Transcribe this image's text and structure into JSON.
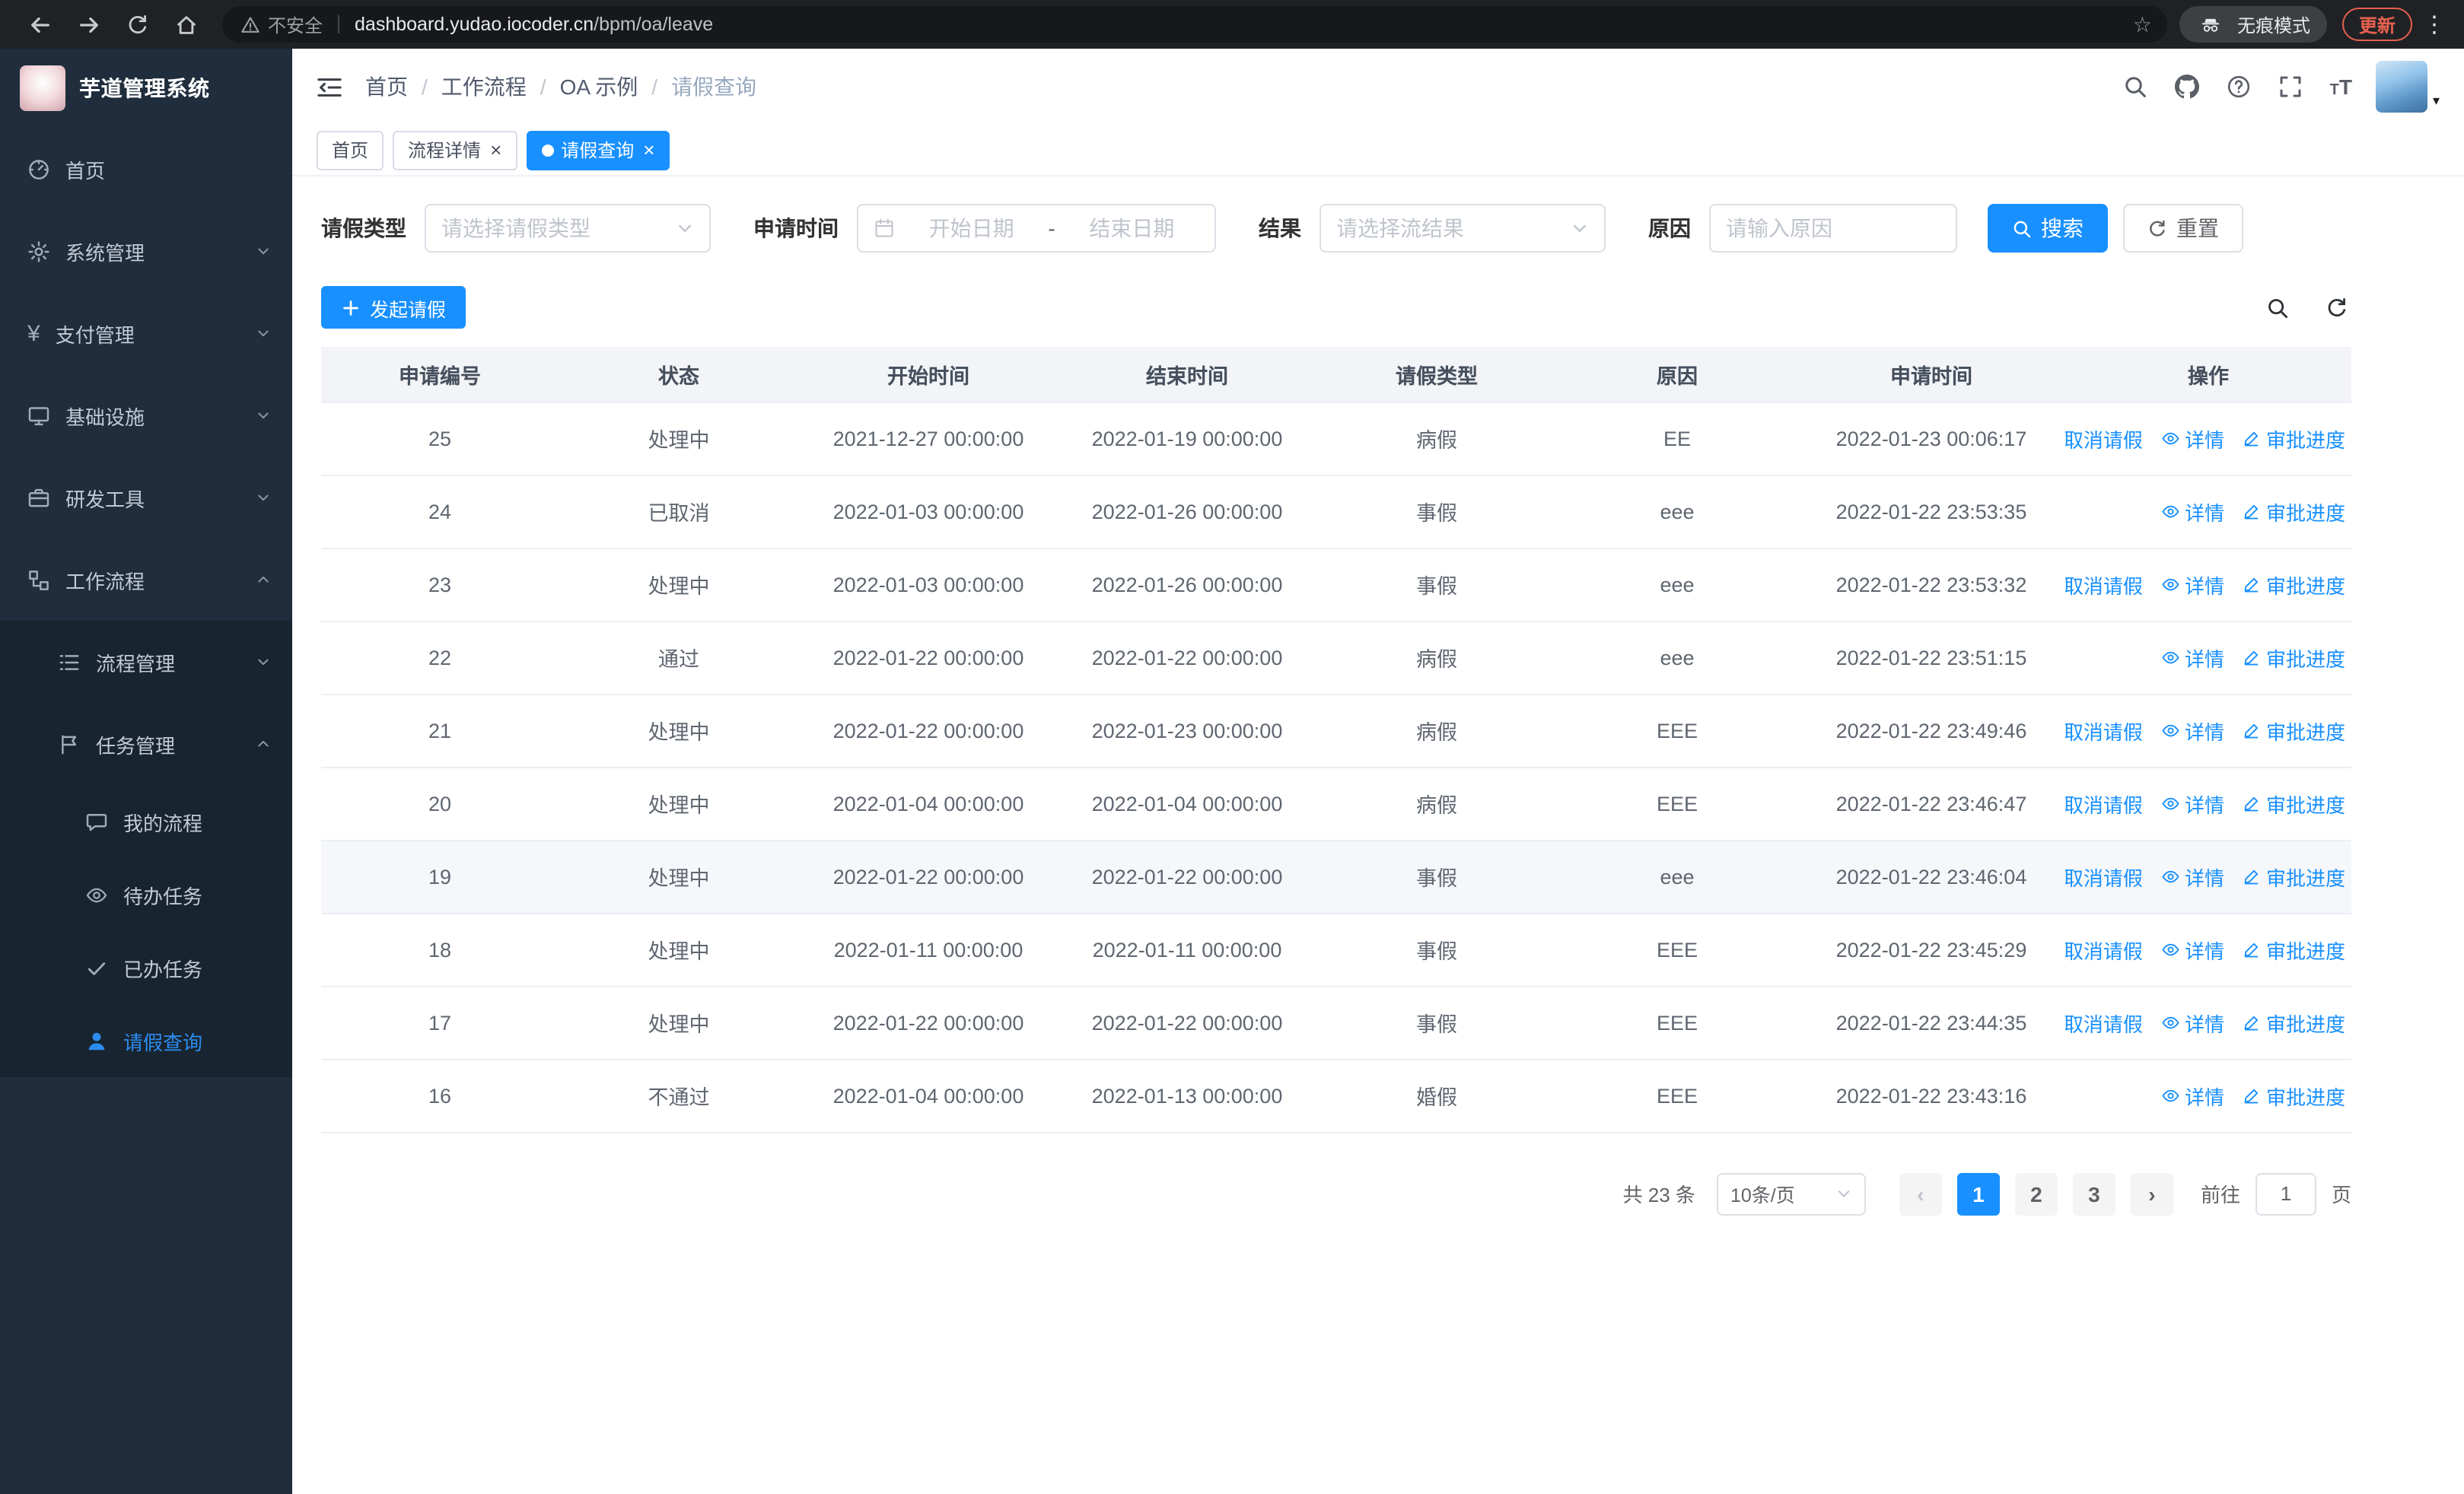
{
  "browser": {
    "security_warning": "不安全",
    "url_domain": "dashboard.yudao.iocoder.cn",
    "url_path": "/bpm/oa/leave",
    "incognito_label": "无痕模式",
    "update_label": "更新"
  },
  "colors": {
    "primary": "#1890ff",
    "sidebar_bg": "#1f2d3d",
    "sidebar_submenu_bg": "#18242f",
    "active_menu_text": "#2d8cf0",
    "table_header_bg": "#f3f4f7",
    "update_badge": "#e4604e"
  },
  "sidebar": {
    "logo_title": "芋道管理系统",
    "items": [
      {
        "key": "home",
        "label": "首页",
        "icon": "gauge",
        "level": 1
      },
      {
        "key": "system",
        "label": "系统管理",
        "icon": "gear",
        "level": 1,
        "expandable": true,
        "expanded": false
      },
      {
        "key": "payment",
        "label": "支付管理",
        "icon": "yen",
        "level": 1,
        "expandable": true,
        "expanded": false
      },
      {
        "key": "infrastructure",
        "label": "基础设施",
        "icon": "monitor",
        "level": 1,
        "expandable": true,
        "expanded": false
      },
      {
        "key": "devtools",
        "label": "研发工具",
        "icon": "briefcase",
        "level": 1,
        "expandable": true,
        "expanded": false
      },
      {
        "key": "workflow",
        "label": "工作流程",
        "icon": "flow",
        "level": 1,
        "expandable": true,
        "expanded": true
      },
      {
        "key": "process-mgmt",
        "label": "流程管理",
        "icon": "list",
        "level": 2,
        "expandable": true,
        "expanded": false
      },
      {
        "key": "task-mgmt",
        "label": "任务管理",
        "icon": "flag",
        "level": 2,
        "expandable": true,
        "expanded": true
      },
      {
        "key": "my-process",
        "label": "我的流程",
        "icon": "chat",
        "level": 3
      },
      {
        "key": "todo-tasks",
        "label": "待办任务",
        "icon": "eye",
        "level": 3
      },
      {
        "key": "done-tasks",
        "label": "已办任务",
        "icon": "check",
        "level": 3
      },
      {
        "key": "leave-query",
        "label": "请假查询",
        "icon": "user",
        "level": 3,
        "active": true
      }
    ]
  },
  "header": {
    "breadcrumb": [
      "首页",
      "工作流程",
      "OA 示例",
      "请假查询"
    ],
    "actions": [
      {
        "icon": "search",
        "name": "search-icon"
      },
      {
        "icon": "github",
        "name": "github-icon"
      },
      {
        "icon": "question",
        "name": "help-icon"
      },
      {
        "icon": "fullscreen",
        "name": "fullscreen-icon"
      },
      {
        "icon": "fontsize",
        "name": "font-size-icon"
      }
    ]
  },
  "tabs": [
    {
      "key": "home",
      "label": "首页",
      "closable": false,
      "active": false
    },
    {
      "key": "process-detail",
      "label": "流程详情",
      "closable": true,
      "active": false
    },
    {
      "key": "leave-query",
      "label": "请假查询",
      "closable": true,
      "active": true
    }
  ],
  "filters": {
    "leave_type_label": "请假类型",
    "leave_type_placeholder": "请选择请假类型",
    "apply_time_label": "申请时间",
    "start_date_placeholder": "开始日期",
    "range_separator": "-",
    "end_date_placeholder": "结束日期",
    "result_label": "结果",
    "result_placeholder": "请选择流结果",
    "reason_label": "原因",
    "reason_placeholder": "请输入原因",
    "search_label": "搜索",
    "reset_label": "重置"
  },
  "toolbar": {
    "create_label": "发起请假"
  },
  "table": {
    "columns": [
      "申请编号",
      "状态",
      "开始时间",
      "结束时间",
      "请假类型",
      "原因",
      "申请时间",
      "操作"
    ],
    "actions": {
      "cancel": "取消请假",
      "detail": "详情",
      "progress": "审批进度"
    },
    "rows": [
      {
        "id": "25",
        "status": "处理中",
        "start": "2021-12-27 00:00:00",
        "end": "2022-01-19 00:00:00",
        "type": "病假",
        "reason": "EE",
        "apply": "2022-01-23 00:06:17",
        "cancellable": true,
        "highlighted": false
      },
      {
        "id": "24",
        "status": "已取消",
        "start": "2022-01-03 00:00:00",
        "end": "2022-01-26 00:00:00",
        "type": "事假",
        "reason": "eee",
        "apply": "2022-01-22 23:53:35",
        "cancellable": false,
        "highlighted": false
      },
      {
        "id": "23",
        "status": "处理中",
        "start": "2022-01-03 00:00:00",
        "end": "2022-01-26 00:00:00",
        "type": "事假",
        "reason": "eee",
        "apply": "2022-01-22 23:53:32",
        "cancellable": true,
        "highlighted": false
      },
      {
        "id": "22",
        "status": "通过",
        "start": "2022-01-22 00:00:00",
        "end": "2022-01-22 00:00:00",
        "type": "病假",
        "reason": "eee",
        "apply": "2022-01-22 23:51:15",
        "cancellable": false,
        "highlighted": false
      },
      {
        "id": "21",
        "status": "处理中",
        "start": "2022-01-22 00:00:00",
        "end": "2022-01-23 00:00:00",
        "type": "病假",
        "reason": "EEE",
        "apply": "2022-01-22 23:49:46",
        "cancellable": true,
        "highlighted": false
      },
      {
        "id": "20",
        "status": "处理中",
        "start": "2022-01-04 00:00:00",
        "end": "2022-01-04 00:00:00",
        "type": "病假",
        "reason": "EEE",
        "apply": "2022-01-22 23:46:47",
        "cancellable": true,
        "highlighted": false
      },
      {
        "id": "19",
        "status": "处理中",
        "start": "2022-01-22 00:00:00",
        "end": "2022-01-22 00:00:00",
        "type": "事假",
        "reason": "eee",
        "apply": "2022-01-22 23:46:04",
        "cancellable": true,
        "highlighted": true
      },
      {
        "id": "18",
        "status": "处理中",
        "start": "2022-01-11 00:00:00",
        "end": "2022-01-11 00:00:00",
        "type": "事假",
        "reason": "EEE",
        "apply": "2022-01-22 23:45:29",
        "cancellable": true,
        "highlighted": false
      },
      {
        "id": "17",
        "status": "处理中",
        "start": "2022-01-22 00:00:00",
        "end": "2022-01-22 00:00:00",
        "type": "事假",
        "reason": "EEE",
        "apply": "2022-01-22 23:44:35",
        "cancellable": true,
        "highlighted": false
      },
      {
        "id": "16",
        "status": "不通过",
        "start": "2022-01-04 00:00:00",
        "end": "2022-01-13 00:00:00",
        "type": "婚假",
        "reason": "EEE",
        "apply": "2022-01-22 23:43:16",
        "cancellable": false,
        "highlighted": false
      }
    ]
  },
  "pagination": {
    "total": "共 23 条",
    "page_size": "10条/页",
    "pages": [
      "1",
      "2",
      "3"
    ],
    "active_page": "1",
    "prev_symbol": "‹",
    "next_symbol": "›",
    "goto_label": "前往",
    "goto_value": "1",
    "page_suffix": "页"
  }
}
